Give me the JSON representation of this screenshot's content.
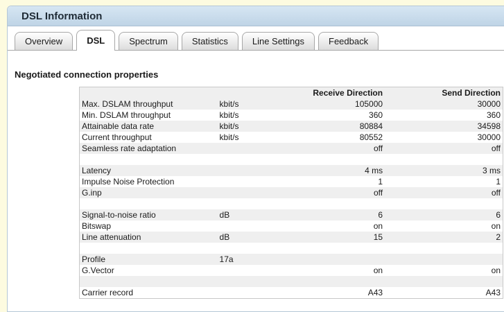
{
  "window": {
    "title": "DSL Information"
  },
  "tabs": [
    {
      "label": "Overview",
      "active": false
    },
    {
      "label": "DSL",
      "active": true
    },
    {
      "label": "Spectrum",
      "active": false
    },
    {
      "label": "Statistics",
      "active": false
    },
    {
      "label": "Line Settings",
      "active": false
    },
    {
      "label": "Feedback",
      "active": false
    }
  ],
  "section": {
    "title": "Negotiated connection properties",
    "columns": {
      "receive": "Receive Direction",
      "send": "Send Direction"
    },
    "rows": [
      {
        "name": "Max. DSLAM throughput",
        "unit": "kbit/s",
        "receive": "105000",
        "send": "30000"
      },
      {
        "name": "Min. DSLAM throughput",
        "unit": "kbit/s",
        "receive": "360",
        "send": "360"
      },
      {
        "name": "Attainable data rate",
        "unit": "kbit/s",
        "receive": "80884",
        "send": "34598"
      },
      {
        "name": "Current throughput",
        "unit": "kbit/s",
        "receive": "80552",
        "send": "30000"
      },
      {
        "name": "Seamless rate adaptation",
        "unit": "",
        "receive": "off",
        "send": "off"
      },
      {
        "name": "",
        "unit": "",
        "receive": "",
        "send": ""
      },
      {
        "name": "Latency",
        "unit": "",
        "receive": "4 ms",
        "send": "3 ms"
      },
      {
        "name": "Impulse Noise Protection",
        "unit": "",
        "receive": "1",
        "send": "1"
      },
      {
        "name": "G.inp",
        "unit": "",
        "receive": "off",
        "send": "off"
      },
      {
        "name": "",
        "unit": "",
        "receive": "",
        "send": ""
      },
      {
        "name": "Signal-to-noise ratio",
        "unit": "dB",
        "receive": "6",
        "send": "6"
      },
      {
        "name": "Bitswap",
        "unit": "",
        "receive": "on",
        "send": "on"
      },
      {
        "name": "Line attenuation",
        "unit": "dB",
        "receive": "15",
        "send": "2"
      },
      {
        "name": "",
        "unit": "",
        "receive": "",
        "send": ""
      },
      {
        "name": "Profile",
        "unit": "17a",
        "receive": "",
        "send": ""
      },
      {
        "name": "G.Vector",
        "unit": "",
        "receive": "on",
        "send": "on"
      },
      {
        "name": "",
        "unit": "",
        "receive": "",
        "send": ""
      },
      {
        "name": "Carrier record",
        "unit": "",
        "receive": "A43",
        "send": "A43"
      }
    ]
  }
}
